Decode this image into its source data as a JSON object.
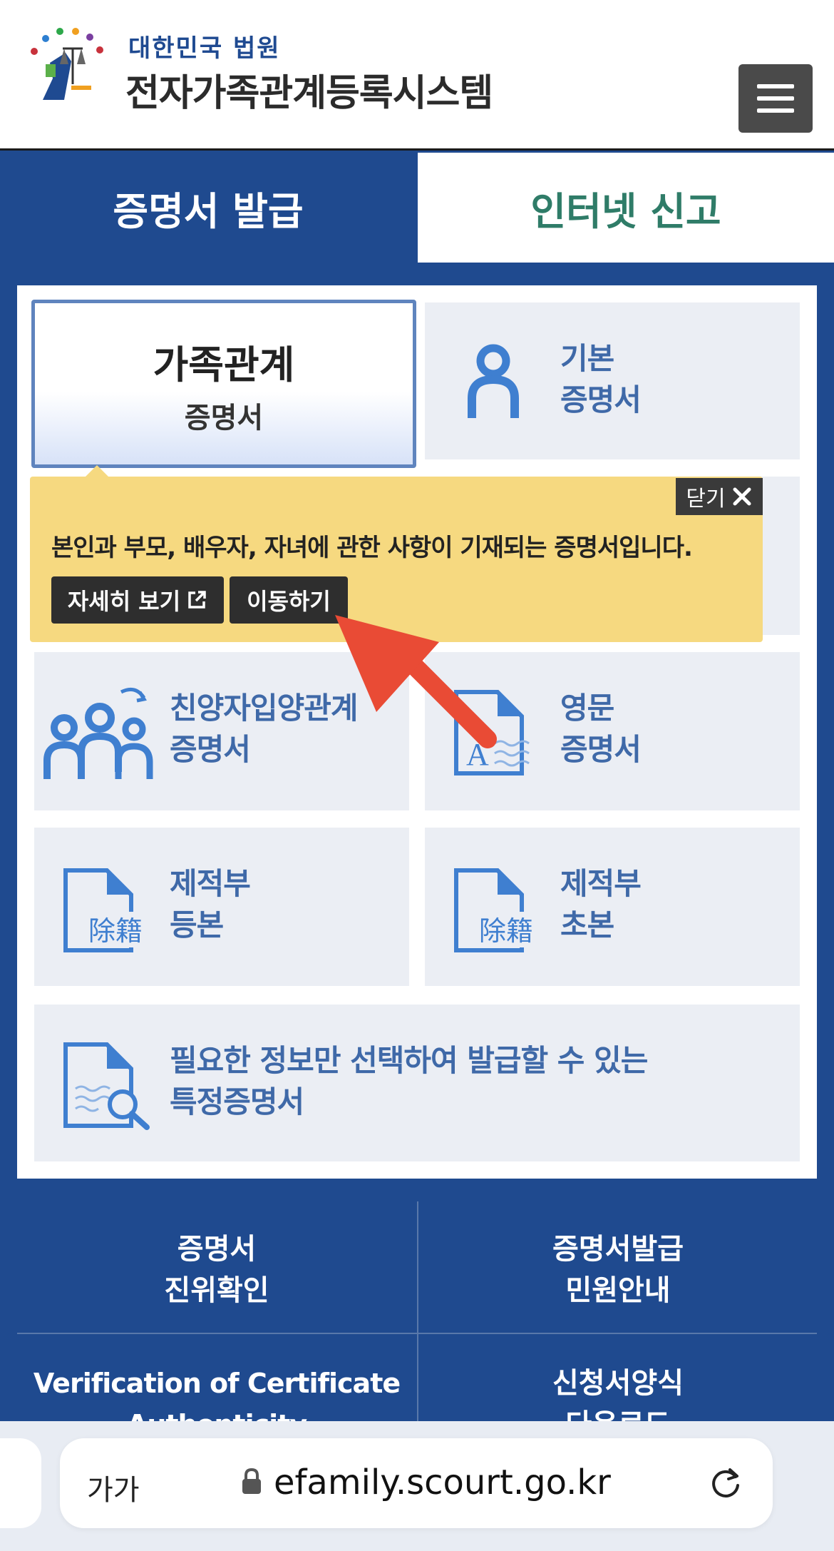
{
  "header": {
    "org": "대한민국 법원",
    "title": "전자가족관계등록시스템",
    "logo": "supreme-court-emblem",
    "menu_icon": "hamburger-icon"
  },
  "tabs": [
    {
      "label": "증명서 발급",
      "active": true
    },
    {
      "label": "인터넷 신고",
      "active": false
    }
  ],
  "cards": {
    "family": {
      "line1": "가족관계",
      "line2": "증명서",
      "selected": true
    },
    "basic": {
      "line1": "기본",
      "line2": "증명서"
    },
    "adoption": {
      "line1": "친양자입양관계",
      "line2": "증명서"
    },
    "english": {
      "line1": "영문",
      "line2": "증명서"
    },
    "removed_full": {
      "line1": "제적부",
      "line2": "등본"
    },
    "removed_partial": {
      "line1": "제적부",
      "line2": "초본"
    },
    "special": {
      "line1": "필요한 정보만 선택하여 발급할 수 있는",
      "line2": "특정증명서"
    }
  },
  "tooltip": {
    "close_label": "닫기",
    "description": "본인과 부모, 배우자, 자녀에 관한 사항이 기재되는 증명서입니다.",
    "detail_button": "자세히 보기",
    "go_button": "이동하기"
  },
  "footer_links": [
    {
      "line1": "증명서",
      "line2": "진위확인"
    },
    {
      "line1": "증명서발급",
      "line2": "민원안내"
    },
    {
      "line1": "Verification of Certificate",
      "line2": "Authenticity"
    },
    {
      "line1": "신청서양식",
      "line2": "다운로드"
    }
  ],
  "browser": {
    "text_size": "가가",
    "url": "efamily.scourt.go.kr"
  },
  "colors": {
    "primary_blue": "#1f4a8f",
    "card_bg": "#ebeef4",
    "card_text": "#3f69a8",
    "tooltip_bg": "#f6d980",
    "tab_inactive_text": "#2f7c68",
    "annotation_arrow": "#e94b35"
  }
}
